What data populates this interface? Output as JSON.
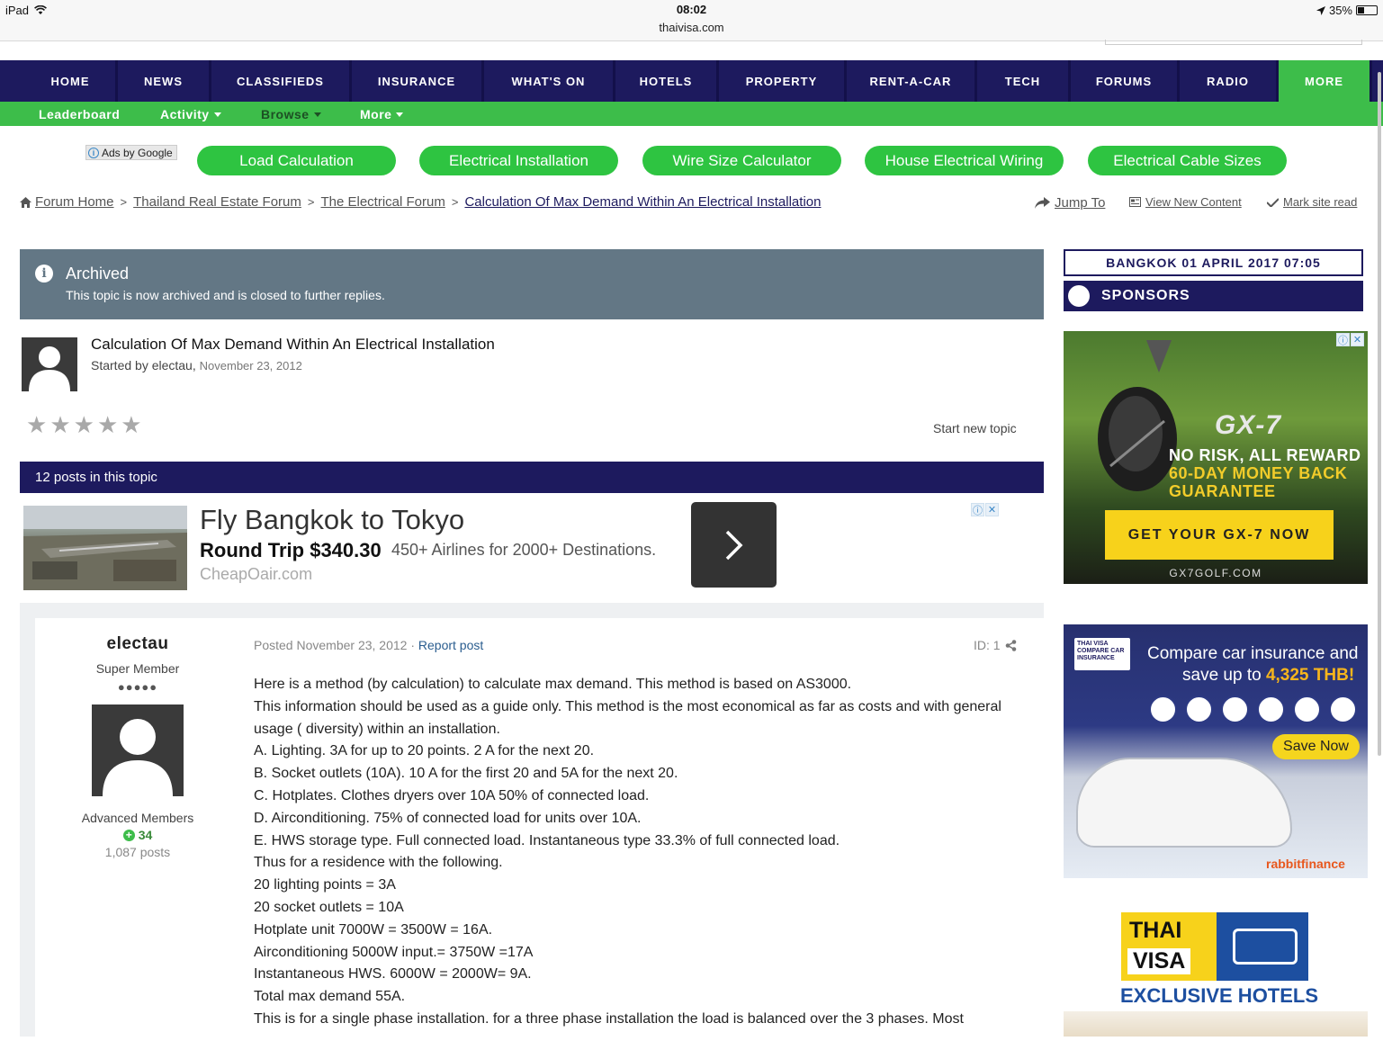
{
  "statusbar": {
    "device": "iPad",
    "time": "08:02",
    "url": "thaivisa.com",
    "battery": "35%",
    "icons": [
      "wifi-icon",
      "location-arrow-icon",
      "battery-icon"
    ]
  },
  "nav": {
    "items": [
      "HOME",
      "NEWS",
      "CLASSIFIEDS",
      "INSURANCE",
      "WHAT'S ON",
      "HOTELS",
      "PROPERTY",
      "RENT-A-CAR",
      "TECH",
      "FORUMS",
      "RADIO",
      "MORE"
    ],
    "active": "MORE",
    "sub": {
      "leaderboard": "Leaderboard",
      "activity": "Activity",
      "browse": "Browse",
      "more": "More"
    }
  },
  "adlinks": {
    "ads_by": "Ads by Google",
    "links": [
      "Load Calculation",
      "Electrical Installation",
      "Wire Size Calculator",
      "House Electrical Wiring",
      "Electrical Cable Sizes"
    ]
  },
  "breadcrumb": {
    "items": [
      "Forum Home",
      "Thailand Real Estate Forum",
      "The Electrical Forum",
      "Calculation Of Max Demand Within An Electrical Installation"
    ],
    "jump_to": "Jump To",
    "view_new": "View New Content",
    "mark_read": "Mark site read"
  },
  "archived": {
    "title": "Archived",
    "message": "This topic is now archived and is closed to further replies."
  },
  "topic": {
    "title": "Calculation Of Max Demand Within An Electrical Installation",
    "started_by": "Started by electau,",
    "date": "November 23, 2012",
    "rating": 0,
    "rating_max": 5,
    "start_new": "Start new topic",
    "posts_count": "12 posts in this topic"
  },
  "flight_ad": {
    "title": "Fly Bangkok to Tokyo",
    "price": "Round Trip $340.30",
    "desc": "450+ Airlines for 2000+ Destinations.",
    "url": "CheapOair.com"
  },
  "post": {
    "author": "electau",
    "rank": "Super Member",
    "pips": "●●●●●",
    "group": "Advanced Members",
    "reputation": "34",
    "post_count": "1,087 posts",
    "posted": "Posted November 23, 2012 ·",
    "report": "Report post",
    "id": "ID: 1",
    "lines": [
      "Here is a method (by calculation) to calculate max demand. This method is based on AS3000.",
      "This information should be used as a guide only. This method is the most economical as far as costs and with general",
      "usage ( diversity) within an installation.",
      "A. Lighting. 3A for up to 20 points. 2 A for the next 20.",
      "B. Socket outlets (10A). 10 A for the first 20 and 5A for the next 20.",
      "C. Hotplates. Clothes dryers over 10A 50% of connected load.",
      "D. Airconditioning. 75% of connected load for units over 10A.",
      "E. HWS storage type. Full connected load. Instantaneous type 33.3% of full connected load.",
      "Thus for a residence with the following.",
      "20 lighting points = 3A",
      "20 socket outlets = 10A",
      "Hotplate unit 7000W = 3500W = 16A.",
      "Airconditioning 5000W input.= 3750W =17A",
      "Instantaneous HWS. 6000W = 2000W= 9A.",
      "Total max demand 55A.",
      "This is for a single phase installation. for a three phase installation the load is balanced over the 3 phases. Most"
    ]
  },
  "sidebar": {
    "clock": "BANGKOK 01 APRIL 2017 07:05",
    "sponsors": "SPONSORS",
    "gx_ad": {
      "logo": "GX-7",
      "line1": "NO RISK, ALL REWARD",
      "line2": "60-DAY MONEY BACK",
      "line3": "GUARANTEE",
      "button": "GET YOUR GX-7 NOW",
      "url": "GX7GOLF.COM"
    },
    "insurance_ad": {
      "badge": "THAI VISA COMPARE CAR INSURANCE",
      "line1": "Compare car insurance and",
      "line2_prefix": "save up to",
      "line2_amount": "4,325 THB!",
      "button": "Save Now",
      "brand": "rabbitfinance"
    },
    "hotel_ad": {
      "thai": "THAI",
      "visa": "VISA",
      "tagline": "EXCLUSIVE HOTELS"
    }
  }
}
